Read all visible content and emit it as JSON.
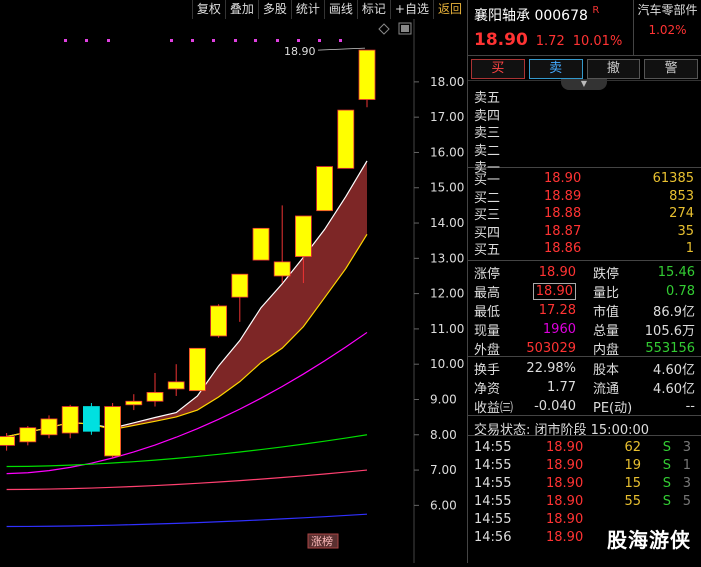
{
  "toolbar": {
    "items": [
      "复权",
      "叠加",
      "多股",
      "统计",
      "画线",
      "标记",
      "+自选",
      "返回"
    ]
  },
  "chart": {
    "y_ticks": [
      "18.00",
      "17.00",
      "16.00",
      "15.00",
      "14.00",
      "13.00",
      "12.00",
      "11.00",
      "10.00",
      "9.00",
      "8.00",
      "7.00",
      "6.00"
    ],
    "high_label": "18.90",
    "limit_tag": "涨榜",
    "colors": {
      "up": "#ffff00",
      "down": "#00e0e0",
      "band": "#8b2a2a",
      "ma1": "#ffffff",
      "ma2": "#ff00ff",
      "ma3": "#00dd00",
      "ma4": "#ff4070",
      "ma5": "#3030ff"
    }
  },
  "chart_data": {
    "type": "candlestick",
    "y_range": [
      5.5,
      19.3
    ],
    "candles": [
      {
        "o": 7.7,
        "c": 7.95,
        "h": 8.05,
        "l": 7.55,
        "up": true
      },
      {
        "o": 7.8,
        "c": 8.2,
        "h": 8.25,
        "l": 7.7,
        "up": true
      },
      {
        "o": 8.0,
        "c": 8.45,
        "h": 8.55,
        "l": 7.9,
        "up": true
      },
      {
        "o": 8.05,
        "c": 8.8,
        "h": 8.85,
        "l": 7.9,
        "up": true
      },
      {
        "o": 8.8,
        "c": 8.1,
        "h": 8.9,
        "l": 8.0,
        "up": false
      },
      {
        "o": 8.8,
        "c": 7.4,
        "h": 8.9,
        "l": 7.35,
        "up": true
      },
      {
        "o": 8.85,
        "c": 8.95,
        "h": 9.15,
        "l": 8.7,
        "up": true
      },
      {
        "o": 8.95,
        "c": 9.2,
        "h": 9.75,
        "l": 8.8,
        "up": true
      },
      {
        "o": 9.3,
        "c": 9.5,
        "h": 10.0,
        "l": 9.1,
        "up": true
      },
      {
        "o": 9.25,
        "c": 10.45,
        "h": 10.45,
        "l": 9.25,
        "up": true
      },
      {
        "o": 10.8,
        "c": 11.65,
        "h": 11.7,
        "l": 10.75,
        "up": true
      },
      {
        "o": 11.9,
        "c": 12.55,
        "h": 12.55,
        "l": 11.2,
        "up": true
      },
      {
        "o": 12.95,
        "c": 13.85,
        "h": 13.85,
        "l": 12.95,
        "up": true
      },
      {
        "o": 12.5,
        "c": 12.9,
        "h": 14.5,
        "l": 12.3,
        "up": true
      },
      {
        "o": 13.05,
        "c": 14.2,
        "h": 14.2,
        "l": 12.3,
        "up": true
      },
      {
        "o": 14.35,
        "c": 15.6,
        "h": 15.6,
        "l": 14.35,
        "up": true
      },
      {
        "o": 15.55,
        "c": 17.2,
        "h": 17.2,
        "l": 15.55,
        "up": true
      },
      {
        "o": 17.5,
        "c": 18.9,
        "h": 18.9,
        "l": 17.28,
        "up": true
      }
    ]
  },
  "stock": {
    "name": "襄阳轴承",
    "code": "000678",
    "flag": "R",
    "price": "18.90",
    "change": "1.72",
    "change_pct": "10.01%",
    "sector_name": "汽车零部件",
    "sector_pct": "1.02%"
  },
  "trade_buttons": {
    "buy": "买",
    "sell": "卖",
    "cancel": "撤",
    "alert": "警"
  },
  "asks": [
    {
      "label": "卖五",
      "price": "",
      "vol": ""
    },
    {
      "label": "卖四",
      "price": "",
      "vol": ""
    },
    {
      "label": "卖三",
      "price": "",
      "vol": ""
    },
    {
      "label": "卖二",
      "price": "",
      "vol": ""
    },
    {
      "label": "卖一",
      "price": "",
      "vol": ""
    }
  ],
  "bids": [
    {
      "label": "买一",
      "price": "18.90",
      "vol": "61385"
    },
    {
      "label": "买二",
      "price": "18.89",
      "vol": "853"
    },
    {
      "label": "买三",
      "price": "18.88",
      "vol": "274"
    },
    {
      "label": "买四",
      "price": "18.87",
      "vol": "35"
    },
    {
      "label": "买五",
      "price": "18.86",
      "vol": "1"
    }
  ],
  "stats": [
    {
      "l1": "涨停",
      "v1": "18.90",
      "c1": "#f33",
      "l2": "跌停",
      "v2": "15.46",
      "c2": "#3c3"
    },
    {
      "l1": "最高",
      "v1": "18.90",
      "c1": "#f33",
      "l2": "量比",
      "v2": "0.78",
      "c2": "#3c3"
    },
    {
      "l1": "最低",
      "v1": "17.28",
      "c1": "#f33",
      "l2": "市值",
      "v2": "86.9亿",
      "c2": "#ddd"
    },
    {
      "l1": "现量",
      "v1": "1960",
      "c1": "#d0d",
      "l2": "总量",
      "v2": "105.6万",
      "c2": "#ddd"
    },
    {
      "l1": "外盘",
      "v1": "503029",
      "c1": "#f33",
      "l2": "内盘",
      "v2": "553156",
      "c2": "#3c3"
    }
  ],
  "stats2": [
    {
      "l1": "换手",
      "v1": "22.98%",
      "l2": "股本",
      "v2": "4.60亿"
    },
    {
      "l1": "净资",
      "v1": "1.77",
      "l2": "流通",
      "v2": "4.60亿"
    },
    {
      "l1": "收益㈢",
      "v1": "-0.040",
      "l2": "PE(动)",
      "v2": "--"
    }
  ],
  "trade_state": "交易状态: 闭市阶段 15:00:00",
  "ticks": [
    {
      "time": "14:55",
      "price": "18.90",
      "vol": "62",
      "side": "S",
      "n": "3"
    },
    {
      "time": "14:55",
      "price": "18.90",
      "vol": "19",
      "side": "S",
      "n": "1"
    },
    {
      "time": "14:55",
      "price": "18.90",
      "vol": "15",
      "side": "S",
      "n": "3"
    },
    {
      "time": "14:55",
      "price": "18.90",
      "vol": "55",
      "side": "S",
      "n": "5"
    },
    {
      "time": "14:55",
      "price": "18.90",
      "vol": "",
      "side": "",
      "n": ""
    },
    {
      "time": "14:56",
      "price": "18.90",
      "vol": "",
      "side": "",
      "n": ""
    }
  ],
  "watermark": "股海游侠"
}
